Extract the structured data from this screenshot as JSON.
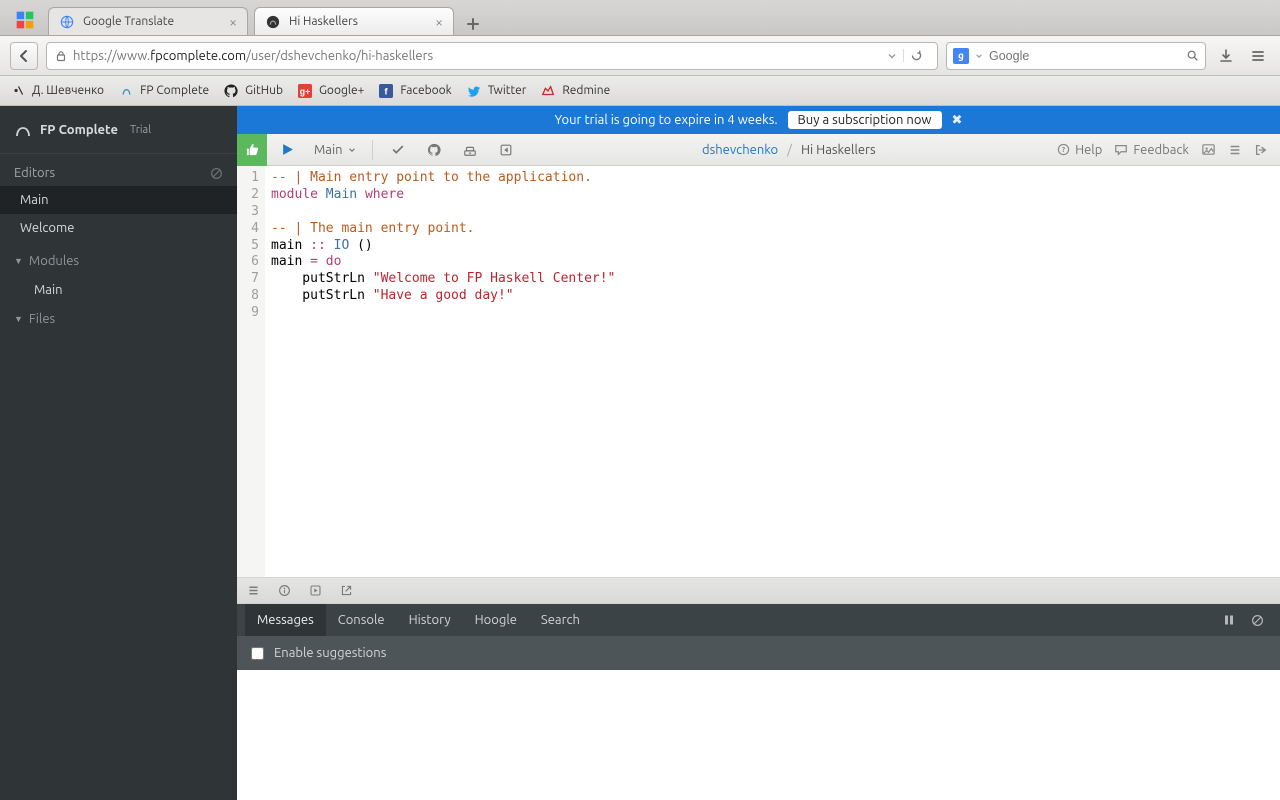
{
  "browser": {
    "tabs": [
      {
        "label": "Google Translate"
      },
      {
        "label": "Hi Haskellers"
      }
    ],
    "url_prefix": "https://www.",
    "url_domain": "fpcomplete.com",
    "url_path": "/user/dshevchenko/hi-haskellers",
    "search_placeholder": "Google"
  },
  "bookmarks": [
    {
      "label": "Д. Шевченко"
    },
    {
      "label": "FP Complete"
    },
    {
      "label": "GitHub"
    },
    {
      "label": "Google+"
    },
    {
      "label": "Facebook"
    },
    {
      "label": "Twitter"
    },
    {
      "label": "Redmine"
    }
  ],
  "sidebar": {
    "brand": "FP Complete",
    "trial": "Trial",
    "editors_label": "Editors",
    "items": [
      {
        "label": "Main"
      },
      {
        "label": "Welcome"
      }
    ],
    "modules_label": "Modules",
    "modules_items": [
      {
        "label": "Main"
      }
    ],
    "files_label": "Files"
  },
  "banner": {
    "text": "Your trial is going to expire in 4 weeks.",
    "cta": "Buy a subscription now"
  },
  "toolbar": {
    "run_target": "Main",
    "user": "dshevchenko",
    "project": "Hi Haskellers",
    "help": "Help",
    "feedback": "Feedback"
  },
  "code": {
    "lines": [
      {
        "n": "1",
        "kind": "comment",
        "text": "-- | Main entry point to the application."
      },
      {
        "n": "2",
        "kind": "module"
      },
      {
        "n": "3",
        "kind": "blank"
      },
      {
        "n": "4",
        "kind": "comment",
        "text": "-- | The main entry point."
      },
      {
        "n": "5",
        "kind": "sig"
      },
      {
        "n": "6",
        "kind": "defdo"
      },
      {
        "n": "7",
        "kind": "put1",
        "str": "\"Welcome to FP Haskell Center!\""
      },
      {
        "n": "8",
        "kind": "put2",
        "str": "\"Have a good day!\""
      },
      {
        "n": "9",
        "kind": "blank"
      }
    ],
    "tokens": {
      "module": "module",
      "main_mod": "Main",
      "where": "where",
      "main_id": "main",
      "coloncolon": "::",
      "io": "IO",
      "unit": "()",
      "eq": "=",
      "do": "do",
      "putstrln": "putStrLn"
    }
  },
  "panel": {
    "tabs": [
      "Messages",
      "Console",
      "History",
      "Hoogle",
      "Search"
    ],
    "active": 0,
    "enable_suggestions": "Enable suggestions"
  }
}
